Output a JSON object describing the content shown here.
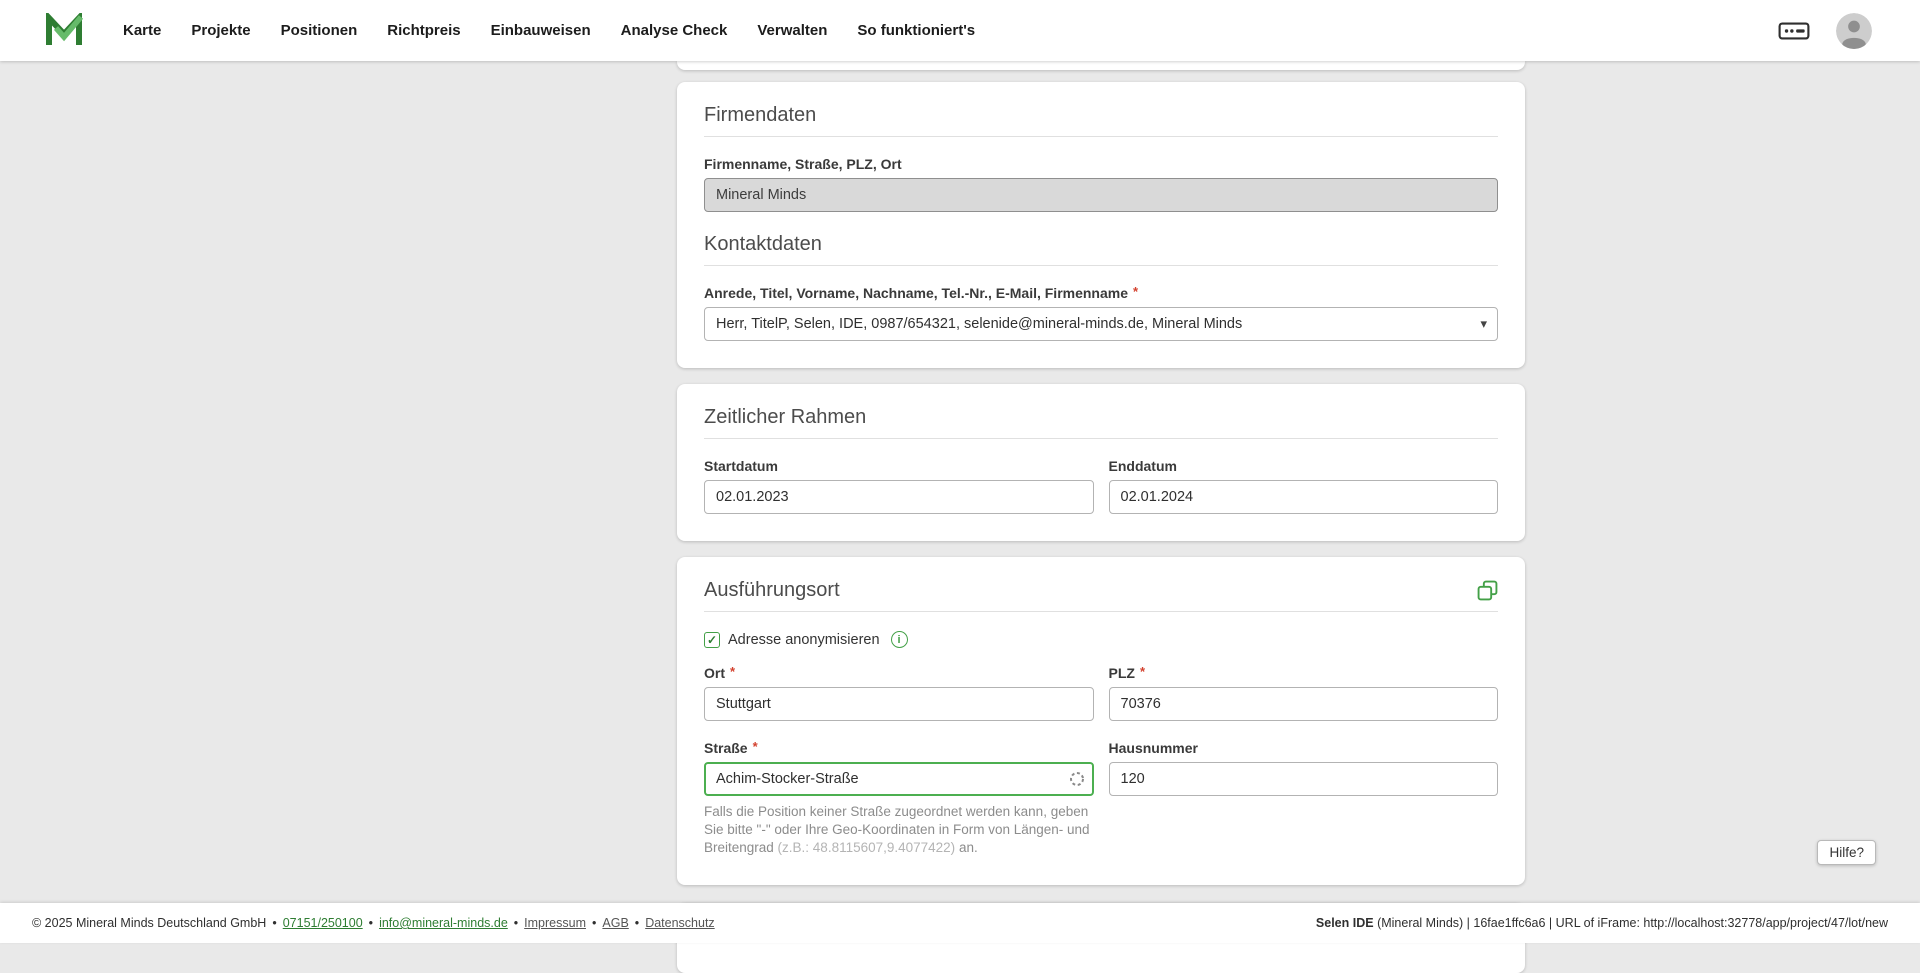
{
  "colors": {
    "accent_green": "#43a047",
    "focus_green": "#4caf50",
    "link_green": "#2e7d32",
    "logo_green_dark": "#2e7d32",
    "logo_green_light": "#66bb6a",
    "background_gray": "#e9e9e9",
    "disabled_input_gray": "#d9d9d9"
  },
  "required_marker": "*",
  "separator": "•",
  "icons": {
    "check": "✓",
    "caret_down": "▾",
    "info": "i"
  },
  "nav": {
    "items": [
      "Karte",
      "Projekte",
      "Positionen",
      "Richtpreis",
      "Einbauweisen",
      "Analyse Check",
      "Verwalten",
      "So funktioniert's"
    ]
  },
  "cards": {
    "firmendaten": {
      "title": "Firmendaten",
      "firma_label": "Firmenname, Straße, PLZ, Ort",
      "firma_value": "Mineral Minds",
      "kontakt_title": "Kontaktdaten",
      "kontakt_label": "Anrede, Titel, Vorname, Nachname, Tel.-Nr., E-Mail, Firmenname",
      "kontakt_value": "Herr, TitelP, Selen, IDE, 0987/654321, selenide@mineral-minds.de, Mineral Minds"
    },
    "zeitraum": {
      "title": "Zeitlicher Rahmen",
      "start_label": "Startdatum",
      "start_value": "02.01.2023",
      "end_label": "Enddatum",
      "end_value": "02.01.2024"
    },
    "ort": {
      "title": "Ausführungsort",
      "anonymize_label": "Adresse anonymisieren",
      "ort_label": "Ort",
      "ort_value": "Stuttgart",
      "plz_label": "PLZ",
      "plz_value": "70376",
      "strasse_label": "Straße",
      "strasse_value": "Achim-Stocker-Straße",
      "hausnummer_label": "Hausnummer",
      "hausnummer_value": "120",
      "help_text": "Falls die Position keiner Straße zugeordnet werden kann, geben Sie bitte \"-\" oder Ihre Geo-Koordinaten in Form von Längen- und Breitengrad ",
      "help_coords": "(z.B.: 48.8115607,9.4077422)",
      "help_suffix": " an."
    }
  },
  "help_button": "Hilfe?",
  "footer": {
    "copyright": "© 2025 Mineral Minds Deutschland GmbH",
    "phone": "07151/250100",
    "email": "info@mineral-minds.de",
    "links": [
      "Impressum",
      "AGB",
      "Datenschutz"
    ],
    "app_name": "Selen IDE",
    "app_info": " (Mineral Minds) | 16fae1ffc6a6 | URL of iFrame: http://localhost:32778/app/project/47/lot/new"
  }
}
